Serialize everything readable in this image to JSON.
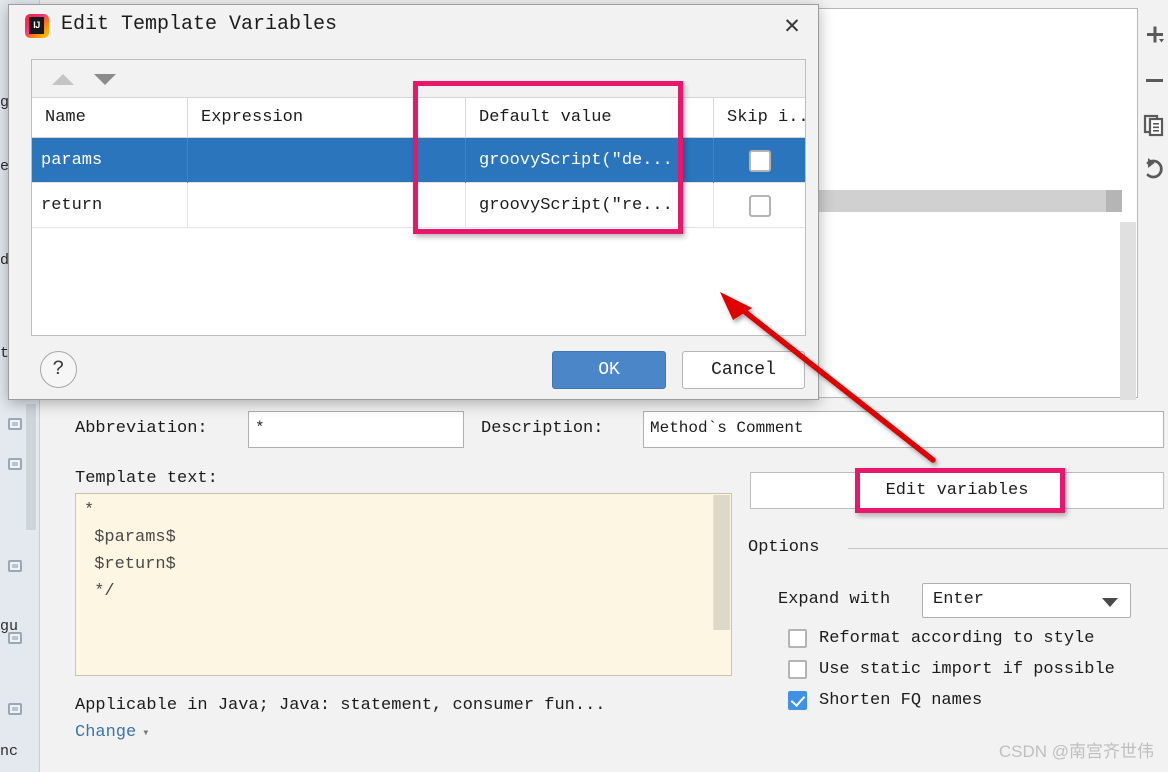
{
  "dialog": {
    "title": "Edit Template Variables",
    "app_icon": "intellij-idea-logo",
    "close_icon": "✕",
    "toolbar": {
      "move_up_icon": "arrow-up-icon",
      "move_down_icon": "arrow-down-icon"
    },
    "table": {
      "columns": [
        "Name",
        "Expression",
        "Default value",
        "Skip i..."
      ],
      "rows": [
        {
          "name": "params",
          "expression": "",
          "default_value": "groovyScript(\"de...",
          "skip_if_defined": false,
          "selected": true
        },
        {
          "name": "return",
          "expression": "",
          "default_value": "groovyScript(\"re...",
          "skip_if_defined": false,
          "selected": false
        }
      ]
    },
    "buttons": {
      "help": "?",
      "ok": "OK",
      "cancel": "Cancel"
    }
  },
  "form": {
    "abbreviation_label": "Abbreviation:",
    "abbreviation_value": "*",
    "description_label": "Description:",
    "description_value": "Method`s Comment",
    "template_text_label": "Template text:",
    "template_text_value": "*\n $params$\n $return$\n */",
    "applicable_text": "Applicable in Java; Java: statement, consumer fun...",
    "change_link": "Change",
    "change_caret_icon": "chevron-down-icon",
    "edit_variables_button": "Edit variables"
  },
  "options": {
    "group_label": "Options",
    "expand_with_label": "Expand with",
    "expand_with_value": "Enter",
    "expand_with_options": [
      "Enter"
    ],
    "checkboxes": [
      {
        "label": "Reformat according to style",
        "checked": false
      },
      {
        "label": "Use static import if possible",
        "checked": false
      },
      {
        "label": "Shorten FQ names",
        "checked": true
      }
    ]
  },
  "right_toolbar": {
    "icons": [
      "add-icon",
      "remove-icon",
      "duplicate-icon",
      "revert-icon"
    ]
  },
  "left_panel": {
    "text_fragments": [
      "g",
      "e",
      "d",
      "t",
      "gu",
      "nc"
    ]
  },
  "annotations": {
    "highlight_color": "#e8176b",
    "arrow_color": "#e00000",
    "highlighted_regions": [
      "default-value-column",
      "edit-variables-button"
    ]
  },
  "watermark": "CSDN @南宫齐世伟"
}
